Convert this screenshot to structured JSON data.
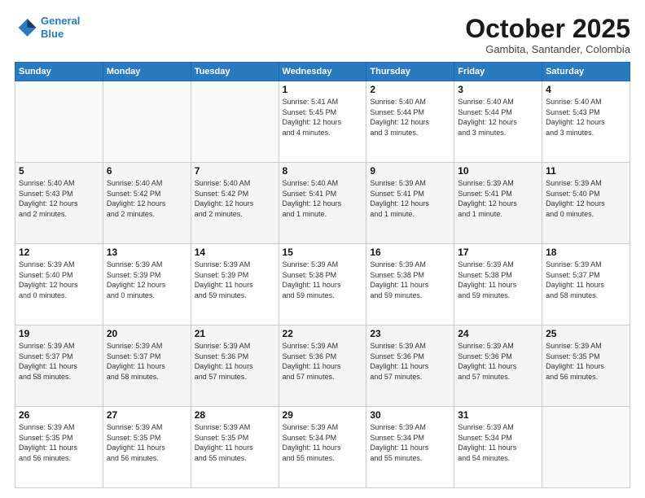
{
  "logo": {
    "line1": "General",
    "line2": "Blue"
  },
  "header": {
    "month": "October 2025",
    "location": "Gambita, Santander, Colombia"
  },
  "days_of_week": [
    "Sunday",
    "Monday",
    "Tuesday",
    "Wednesday",
    "Thursday",
    "Friday",
    "Saturday"
  ],
  "weeks": [
    [
      {
        "day": "",
        "info": ""
      },
      {
        "day": "",
        "info": ""
      },
      {
        "day": "",
        "info": ""
      },
      {
        "day": "1",
        "info": "Sunrise: 5:41 AM\nSunset: 5:45 PM\nDaylight: 12 hours\nand 4 minutes."
      },
      {
        "day": "2",
        "info": "Sunrise: 5:40 AM\nSunset: 5:44 PM\nDaylight: 12 hours\nand 3 minutes."
      },
      {
        "day": "3",
        "info": "Sunrise: 5:40 AM\nSunset: 5:44 PM\nDaylight: 12 hours\nand 3 minutes."
      },
      {
        "day": "4",
        "info": "Sunrise: 5:40 AM\nSunset: 5:43 PM\nDaylight: 12 hours\nand 3 minutes."
      }
    ],
    [
      {
        "day": "5",
        "info": "Sunrise: 5:40 AM\nSunset: 5:43 PM\nDaylight: 12 hours\nand 2 minutes."
      },
      {
        "day": "6",
        "info": "Sunrise: 5:40 AM\nSunset: 5:42 PM\nDaylight: 12 hours\nand 2 minutes."
      },
      {
        "day": "7",
        "info": "Sunrise: 5:40 AM\nSunset: 5:42 PM\nDaylight: 12 hours\nand 2 minutes."
      },
      {
        "day": "8",
        "info": "Sunrise: 5:40 AM\nSunset: 5:41 PM\nDaylight: 12 hours\nand 1 minute."
      },
      {
        "day": "9",
        "info": "Sunrise: 5:39 AM\nSunset: 5:41 PM\nDaylight: 12 hours\nand 1 minute."
      },
      {
        "day": "10",
        "info": "Sunrise: 5:39 AM\nSunset: 5:41 PM\nDaylight: 12 hours\nand 1 minute."
      },
      {
        "day": "11",
        "info": "Sunrise: 5:39 AM\nSunset: 5:40 PM\nDaylight: 12 hours\nand 0 minutes."
      }
    ],
    [
      {
        "day": "12",
        "info": "Sunrise: 5:39 AM\nSunset: 5:40 PM\nDaylight: 12 hours\nand 0 minutes."
      },
      {
        "day": "13",
        "info": "Sunrise: 5:39 AM\nSunset: 5:39 PM\nDaylight: 12 hours\nand 0 minutes."
      },
      {
        "day": "14",
        "info": "Sunrise: 5:39 AM\nSunset: 5:39 PM\nDaylight: 11 hours\nand 59 minutes."
      },
      {
        "day": "15",
        "info": "Sunrise: 5:39 AM\nSunset: 5:38 PM\nDaylight: 11 hours\nand 59 minutes."
      },
      {
        "day": "16",
        "info": "Sunrise: 5:39 AM\nSunset: 5:38 PM\nDaylight: 11 hours\nand 59 minutes."
      },
      {
        "day": "17",
        "info": "Sunrise: 5:39 AM\nSunset: 5:38 PM\nDaylight: 11 hours\nand 59 minutes."
      },
      {
        "day": "18",
        "info": "Sunrise: 5:39 AM\nSunset: 5:37 PM\nDaylight: 11 hours\nand 58 minutes."
      }
    ],
    [
      {
        "day": "19",
        "info": "Sunrise: 5:39 AM\nSunset: 5:37 PM\nDaylight: 11 hours\nand 58 minutes."
      },
      {
        "day": "20",
        "info": "Sunrise: 5:39 AM\nSunset: 5:37 PM\nDaylight: 11 hours\nand 58 minutes."
      },
      {
        "day": "21",
        "info": "Sunrise: 5:39 AM\nSunset: 5:36 PM\nDaylight: 11 hours\nand 57 minutes."
      },
      {
        "day": "22",
        "info": "Sunrise: 5:39 AM\nSunset: 5:36 PM\nDaylight: 11 hours\nand 57 minutes."
      },
      {
        "day": "23",
        "info": "Sunrise: 5:39 AM\nSunset: 5:36 PM\nDaylight: 11 hours\nand 57 minutes."
      },
      {
        "day": "24",
        "info": "Sunrise: 5:39 AM\nSunset: 5:36 PM\nDaylight: 11 hours\nand 57 minutes."
      },
      {
        "day": "25",
        "info": "Sunrise: 5:39 AM\nSunset: 5:35 PM\nDaylight: 11 hours\nand 56 minutes."
      }
    ],
    [
      {
        "day": "26",
        "info": "Sunrise: 5:39 AM\nSunset: 5:35 PM\nDaylight: 11 hours\nand 56 minutes."
      },
      {
        "day": "27",
        "info": "Sunrise: 5:39 AM\nSunset: 5:35 PM\nDaylight: 11 hours\nand 56 minutes."
      },
      {
        "day": "28",
        "info": "Sunrise: 5:39 AM\nSunset: 5:35 PM\nDaylight: 11 hours\nand 55 minutes."
      },
      {
        "day": "29",
        "info": "Sunrise: 5:39 AM\nSunset: 5:34 PM\nDaylight: 11 hours\nand 55 minutes."
      },
      {
        "day": "30",
        "info": "Sunrise: 5:39 AM\nSunset: 5:34 PM\nDaylight: 11 hours\nand 55 minutes."
      },
      {
        "day": "31",
        "info": "Sunrise: 5:39 AM\nSunset: 5:34 PM\nDaylight: 11 hours\nand 54 minutes."
      },
      {
        "day": "",
        "info": ""
      }
    ]
  ]
}
